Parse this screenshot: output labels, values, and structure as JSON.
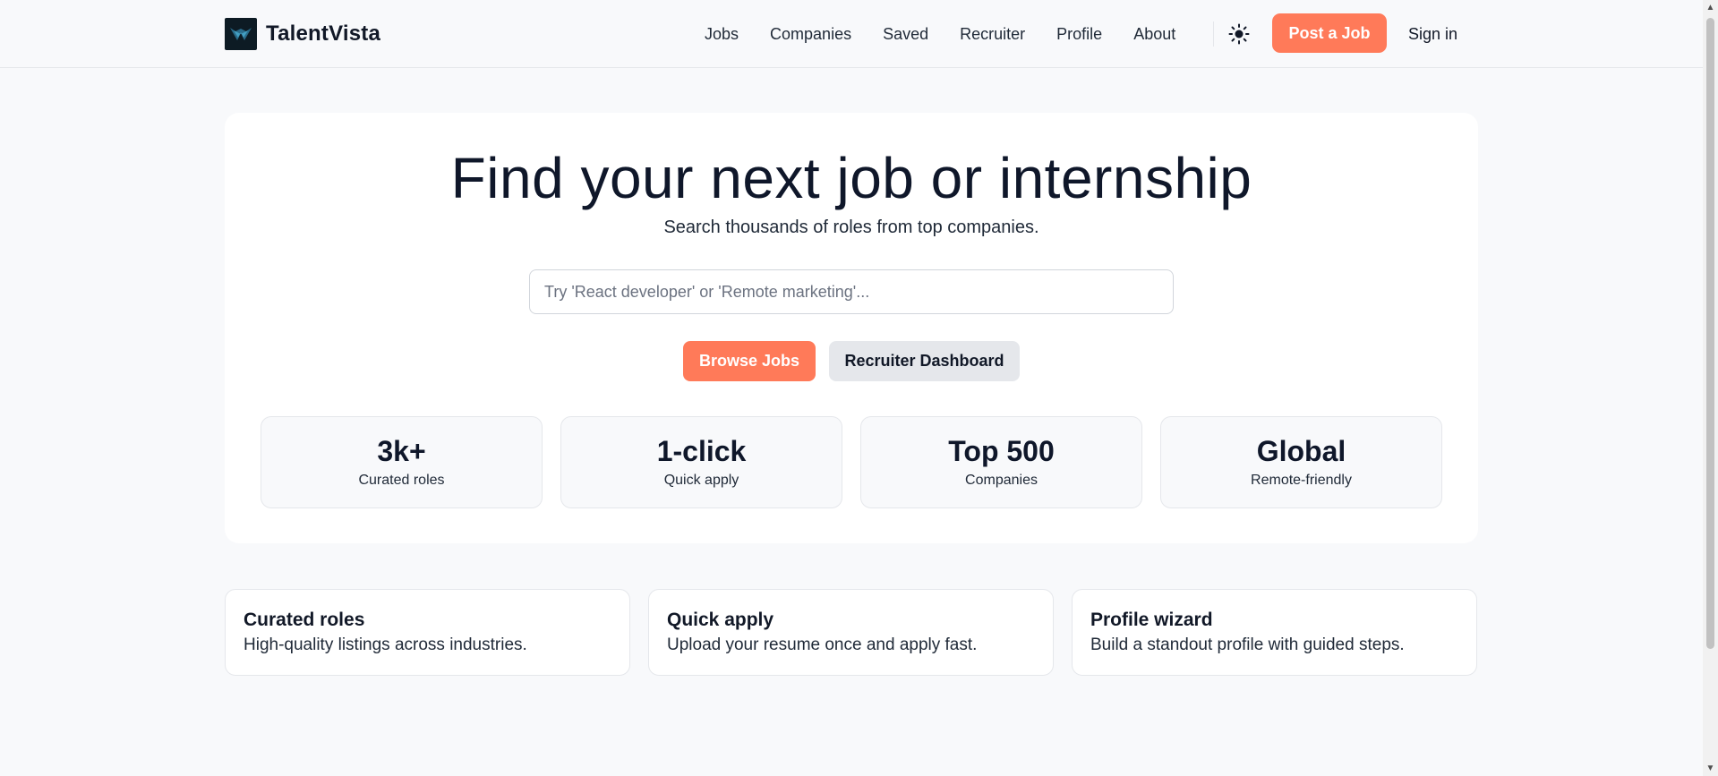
{
  "header": {
    "brand_name": "TalentVista",
    "nav": [
      "Jobs",
      "Companies",
      "Saved",
      "Recruiter",
      "Profile",
      "About"
    ],
    "theme_icon": "sun-icon",
    "post_job_label": "Post a Job",
    "sign_in_label": "Sign in"
  },
  "hero": {
    "title": "Find your next job or internship",
    "subtitle": "Search thousands of roles from top companies.",
    "search_placeholder": "Try 'React developer' or 'Remote marketing'...",
    "search_value": "",
    "browse_label": "Browse Jobs",
    "recruiter_label": "Recruiter Dashboard",
    "stats": [
      {
        "value": "3k+",
        "label": "Curated roles"
      },
      {
        "value": "1-click",
        "label": "Quick apply"
      },
      {
        "value": "Top 500",
        "label": "Companies"
      },
      {
        "value": "Global",
        "label": "Remote-friendly"
      }
    ]
  },
  "features": [
    {
      "title": "Curated roles",
      "desc": "High-quality listings across industries."
    },
    {
      "title": "Quick apply",
      "desc": "Upload your resume once and apply fast."
    },
    {
      "title": "Profile wizard",
      "desc": "Build a standout profile with guided steps."
    }
  ],
  "colors": {
    "accent": "#ff7a59",
    "page_bg": "#f8f9fb",
    "card_bg": "#ffffff",
    "secondary_button": "#e5e7eb",
    "logo_bg": "#0d1b24"
  }
}
